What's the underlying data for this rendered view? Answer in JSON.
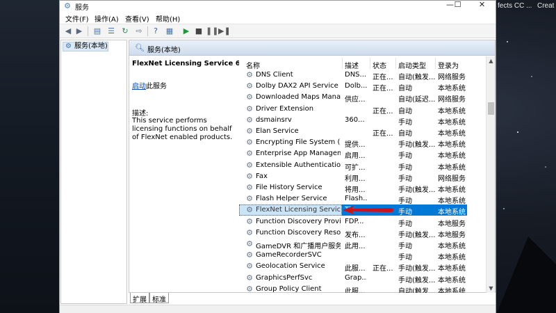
{
  "background": {
    "app_labels": [
      "fects CC ...",
      "Creat"
    ]
  },
  "window": {
    "title": "服务",
    "controls": {
      "minimize": "—",
      "maximize": "☐",
      "close": "✕"
    }
  },
  "menu": [
    {
      "label": "文件(F)"
    },
    {
      "label": "操作(A)"
    },
    {
      "label": "查看(V)"
    },
    {
      "label": "帮助(H)"
    }
  ],
  "tree": {
    "root_label": "服务(本地)"
  },
  "content": {
    "header_title": "服务(本地)",
    "selected_service_name": "FlexNet Licensing Service 64",
    "start_link": "启动",
    "start_suffix": "此服务",
    "description_label": "描述:",
    "description_text": "This service performs licensing functions on behalf of FlexNet enabled products."
  },
  "table": {
    "columns": [
      "名称",
      "描述",
      "状态",
      "启动类型",
      "登录为"
    ],
    "rows": [
      {
        "name": "DNS Client",
        "desc": "DNS...",
        "status": "正在...",
        "startup": "自动(触发...",
        "logon": "网络服务"
      },
      {
        "name": "Dolby DAX2 API Service",
        "desc": "Dolb...",
        "status": "正在...",
        "startup": "自动",
        "logon": "本地系统"
      },
      {
        "name": "Downloaded Maps Manager",
        "desc": "供应...",
        "status": "",
        "startup": "自动(延迟...",
        "logon": "网络服务"
      },
      {
        "name": "Driver Extension",
        "desc": "",
        "status": "正在...",
        "startup": "自动",
        "logon": "本地系统"
      },
      {
        "name": "dsmainsrv",
        "desc": "360...",
        "status": "",
        "startup": "手动",
        "logon": "本地系统"
      },
      {
        "name": "Elan Service",
        "desc": "",
        "status": "正在...",
        "startup": "自动",
        "logon": "本地系统"
      },
      {
        "name": "Encrypting File System (EFS)",
        "desc": "提供...",
        "status": "",
        "startup": "手动(触发...",
        "logon": "本地系统"
      },
      {
        "name": "Enterprise App Manageme...",
        "desc": "启用...",
        "status": "",
        "startup": "手动",
        "logon": "本地系统"
      },
      {
        "name": "Extensible Authentication ...",
        "desc": "可扩...",
        "status": "",
        "startup": "手动",
        "logon": "本地系统"
      },
      {
        "name": "Fax",
        "desc": "利用...",
        "status": "",
        "startup": "手动",
        "logon": "网络服务"
      },
      {
        "name": "File History Service",
        "desc": "将用...",
        "status": "",
        "startup": "手动(触发...",
        "logon": "本地系统"
      },
      {
        "name": "Flash Helper Service",
        "desc": "Flash...",
        "status": "",
        "startup": "手动",
        "logon": "本地系统"
      },
      {
        "name": "FlexNet Licensing Service 64",
        "desc": "Th...",
        "status": "",
        "startup": "手动",
        "logon": "本地系统",
        "selected": true
      },
      {
        "name": "Function Discovery Provide...",
        "desc": "FDP...",
        "status": "",
        "startup": "手动",
        "logon": "本地服务"
      },
      {
        "name": "Function Discovery Resour...",
        "desc": "发布...",
        "status": "",
        "startup": "手动(触发...",
        "logon": "本地服务"
      },
      {
        "name": "GameDVR 和广播用户服务...",
        "desc": "此用...",
        "status": "",
        "startup": "手动",
        "logon": "本地系统"
      },
      {
        "name": "GameRecorderSVC",
        "desc": "",
        "status": "",
        "startup": "手动",
        "logon": "本地系统"
      },
      {
        "name": "Geolocation Service",
        "desc": "此服...",
        "status": "正在...",
        "startup": "手动(触发...",
        "logon": "本地系统"
      },
      {
        "name": "GraphicsPerfSvc",
        "desc": "Grap...",
        "status": "",
        "startup": "手动(触发...",
        "logon": "本地系统"
      },
      {
        "name": "Group Policy Client",
        "desc": "此服...",
        "status": "",
        "startup": "自动(触发...",
        "logon": "本地系统"
      }
    ]
  },
  "tabs": [
    {
      "label": "扩展"
    },
    {
      "label": "标准"
    }
  ],
  "colors": {
    "selection": "#0078d7",
    "header_gradient": "#cfdcec",
    "link": "#0645ad",
    "arrow": "#d0101a",
    "play": "#1b9a38"
  }
}
